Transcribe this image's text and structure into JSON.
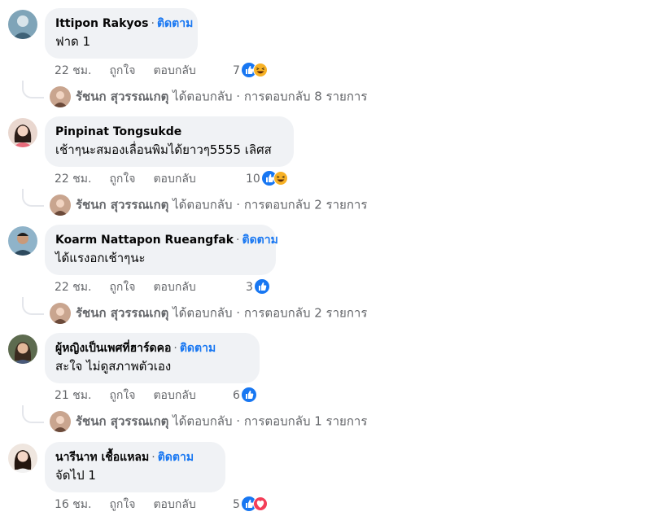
{
  "labels": {
    "follow": "ติดตาม",
    "like": "ถูกใจ",
    "reply": "ตอบกลับ",
    "dot": "·"
  },
  "comments": [
    {
      "author": "Ittipon Rakyos",
      "show_follow": true,
      "text": "ฟาด 1",
      "time": "22 ชม.",
      "reaction_count": "7",
      "reactions": [
        "like-icon",
        "haha-icon"
      ],
      "reply_summary": {
        "replier": "รัชนก สุวรรณเกตุ",
        "replied": "ได้ตอบกลับ",
        "count_text": "การตอบกลับ 8 รายการ"
      }
    },
    {
      "author": "Pinpinat Tongsukde",
      "show_follow": false,
      "text": "เช้าๆนะสมองเลื่อนพิมได้ยาวๆ5555 เลิศส",
      "time": "22 ชม.",
      "reaction_count": "10",
      "reactions": [
        "like-icon",
        "haha-icon"
      ],
      "reply_summary": {
        "replier": "รัชนก สุวรรณเกตุ",
        "replied": "ได้ตอบกลับ",
        "count_text": "การตอบกลับ 2 รายการ"
      }
    },
    {
      "author": "Koarm Nattapon Rueangfak",
      "show_follow": true,
      "text": "ได้แรงอกเช้าๆนะ",
      "time": "22 ชม.",
      "reaction_count": "3",
      "reactions": [
        "like-icon"
      ],
      "reply_summary": {
        "replier": "รัชนก สุวรรณเกตุ",
        "replied": "ได้ตอบกลับ",
        "count_text": "การตอบกลับ 2 รายการ"
      }
    },
    {
      "author": "ผู้หญิงเป็นเพศที่ฮาร์ดคอ",
      "show_follow": true,
      "text": "สะใจ ไม่ดูสภาพตัวเอง",
      "time": "21 ชม.",
      "reaction_count": "6",
      "reactions": [
        "like-icon"
      ],
      "reply_summary": {
        "replier": "รัชนก สุวรรณเกตุ",
        "replied": "ได้ตอบกลับ",
        "count_text": "การตอบกลับ 1 รายการ"
      }
    },
    {
      "author": "นารีนาท เชื้อแหลม",
      "show_follow": true,
      "text": "จัดไป 1",
      "time": "16 ชม.",
      "reaction_count": "5",
      "reactions": [
        "like-icon",
        "love-icon"
      ]
    }
  ]
}
